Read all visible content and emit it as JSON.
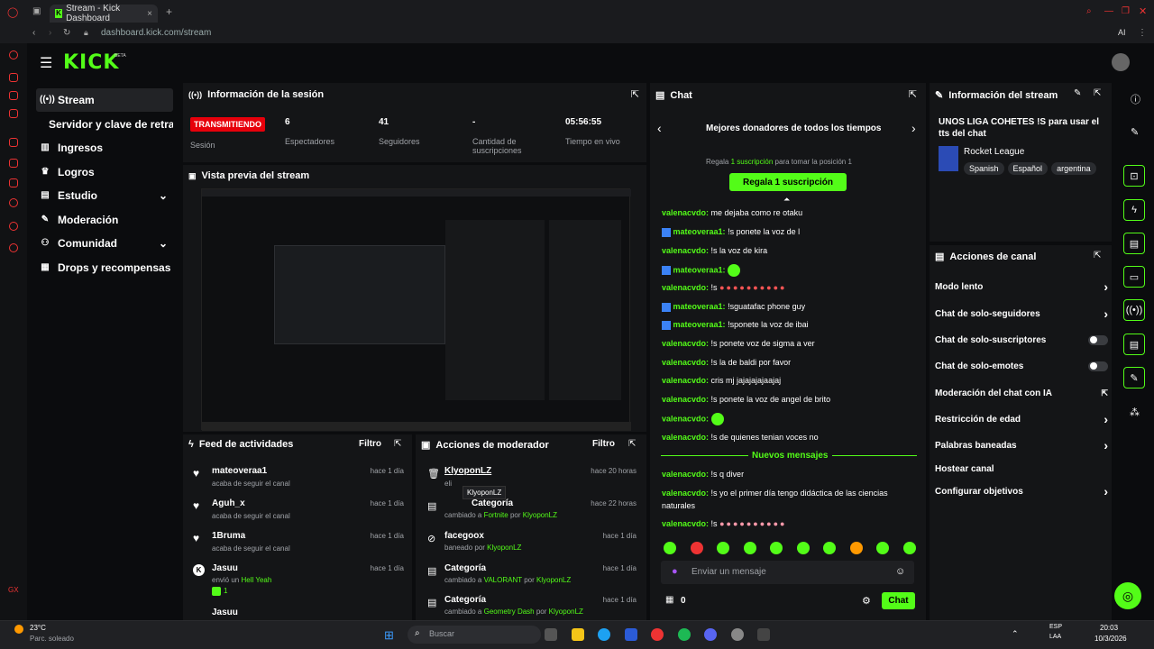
{
  "browser": {
    "tab_title": "Stream - Kick Dashboard",
    "url": "dashboard.kick.com/stream"
  },
  "brand": {
    "logo": "KICK",
    "beta": "BETA",
    "accent": "#53fc18"
  },
  "sidebar": {
    "items": [
      {
        "label": "Stream",
        "icon": "broadcast-icon"
      },
      {
        "label": "Servidor y clave de retransmisión"
      },
      {
        "label": "Ingresos",
        "icon": "chart-icon"
      },
      {
        "label": "Logros",
        "icon": "trophy-icon"
      },
      {
        "label": "Estudio",
        "icon": "studio-icon"
      },
      {
        "label": "Moderación",
        "icon": "wrench-icon"
      },
      {
        "label": "Comunidad",
        "icon": "people-icon"
      },
      {
        "label": "Drops y recompensas",
        "icon": "gift-icon"
      }
    ]
  },
  "session": {
    "title": "Información de la sesión",
    "status": "TRANSMITIENDO",
    "status_label": "Sesión",
    "viewers": "6",
    "viewers_label": "Espectadores",
    "followers": "41",
    "followers_label": "Seguidores",
    "subs": "-",
    "subs_label": "Cantidad de suscripciones",
    "uptime": "05:56:55",
    "uptime_label": "Tiempo en vivo"
  },
  "preview": {
    "title": "Vista previa del stream"
  },
  "feed": {
    "title": "Feed de actividades",
    "filter": "Filtro",
    "rows": [
      {
        "user": "mateoveraa1",
        "text": "acaba de seguir el canal",
        "time": "hace 1 día"
      },
      {
        "user": "Aguh_x",
        "text": "acaba de seguir el canal",
        "time": "hace 1 día"
      },
      {
        "user": "1Bruma",
        "text": "acaba de seguir el canal",
        "time": "hace 1 día"
      },
      {
        "user": "Jasuu",
        "text": "envió un",
        "extra": "Hell Yeah",
        "count": "1",
        "time": "hace 1 día"
      },
      {
        "user": "Jasuu",
        "text": "",
        "time": ""
      }
    ]
  },
  "mod": {
    "title": "Acciones de moderador",
    "filter": "Filtro",
    "tooltip": "KlyoponLZ",
    "rows": [
      {
        "title": "KlyoponLZ",
        "sub": "eli",
        "time": "hace 20 horas"
      },
      {
        "title": "Categoría",
        "sub": "cambiado a",
        "hl": "Fortnite",
        "by": "por",
        "who": "KlyoponLZ",
        "time": "hace 22 horas"
      },
      {
        "title": "facegoox",
        "sub": "baneado por",
        "who": "KlyoponLZ",
        "time": "hace 1 día"
      },
      {
        "title": "Categoría",
        "sub": "cambiado a",
        "hl": "VALORANT",
        "by": "por",
        "who": "KlyoponLZ",
        "time": "hace 1 día"
      },
      {
        "title": "Categoría",
        "sub": "cambiado a",
        "hl": "Geometry Dash",
        "by": "por",
        "who": "KlyoponLZ",
        "time": "hace 1 día"
      }
    ]
  },
  "chat": {
    "title": "Chat",
    "donors": "Mejores donadores de todos los tiempos",
    "gift_pre": "Regala",
    "gift_sub": "1 suscripción",
    "gift_post": "para tomar la posición 1",
    "gift_button": "Regala 1 suscripción",
    "messages": [
      {
        "user": "valenacvdo:",
        "text": "me dejaba como re otaku"
      },
      {
        "user": "mateoveraa1:",
        "text": "!s ponete la voz de l"
      },
      {
        "user": "valenacvdo:",
        "text": "!s la voz de kira"
      },
      {
        "user": "mateoveraa1:",
        "text": ""
      },
      {
        "user": "valenacvdo:",
        "text": "!s"
      },
      {
        "user": "mateoveraa1:",
        "text": "!sguatafac phone guy"
      },
      {
        "user": "mateoveraa1:",
        "text": "!sponete la voz de ibai"
      },
      {
        "user": "valenacvdo:",
        "text": "!s ponete voz de sigma a ver"
      },
      {
        "user": "valenacvdo:",
        "text": "!s la de baldi por favor"
      },
      {
        "user": "valenacvdo:",
        "text": "cris mj jajajajajaajaj"
      },
      {
        "user": "valenacvdo:",
        "text": "!s ponete la voz de angel de brito"
      },
      {
        "user": "valenacvdo:",
        "text": ""
      },
      {
        "user": "valenacvdo:",
        "text": "!s de quienes tenian voces no"
      }
    ],
    "new_messages": "Nuevos mensajes",
    "messages2": [
      {
        "user": "valenacvdo:",
        "text": "!s q diver"
      },
      {
        "user": "valenacvdo:",
        "text": "!s yo el primer día tengo didáctica de las ciencias"
      },
      {
        "user": "",
        "text": "naturales"
      },
      {
        "user": "valenacvdo:",
        "text": "!s"
      }
    ],
    "placeholder": "Enviar un mensaje",
    "points": "0",
    "send": "Chat"
  },
  "streaminfo": {
    "title": "Información del stream",
    "stream_title": "UNOS LIGA COHETES !S para usar el tts del chat",
    "category": "Rocket League",
    "tags": [
      "Spanish",
      "Español",
      "argentina"
    ]
  },
  "actions": {
    "title": "Acciones de canal",
    "items": [
      {
        "label": "Modo lento",
        "kind": "chevron"
      },
      {
        "label": "Chat de solo-seguidores",
        "kind": "chevron"
      },
      {
        "label": "Chat de solo-suscriptores",
        "kind": "toggle"
      },
      {
        "label": "Chat de solo-emotes",
        "kind": "toggle"
      },
      {
        "label": "Moderación del chat con IA",
        "kind": "external"
      },
      {
        "label": "Restricción de edad",
        "kind": "chevron"
      },
      {
        "label": "Palabras baneadas",
        "kind": "chevron"
      },
      {
        "label": "Hostear canal",
        "kind": "none"
      },
      {
        "label": "Configurar objetivos",
        "kind": "chevron"
      }
    ]
  },
  "taskbar": {
    "temp": "23°C",
    "weather": "Parc. soleado",
    "search": "Buscar",
    "lang": "ESP",
    "lang2": "LAA",
    "time": "20:03",
    "date": "10/3/2026"
  }
}
